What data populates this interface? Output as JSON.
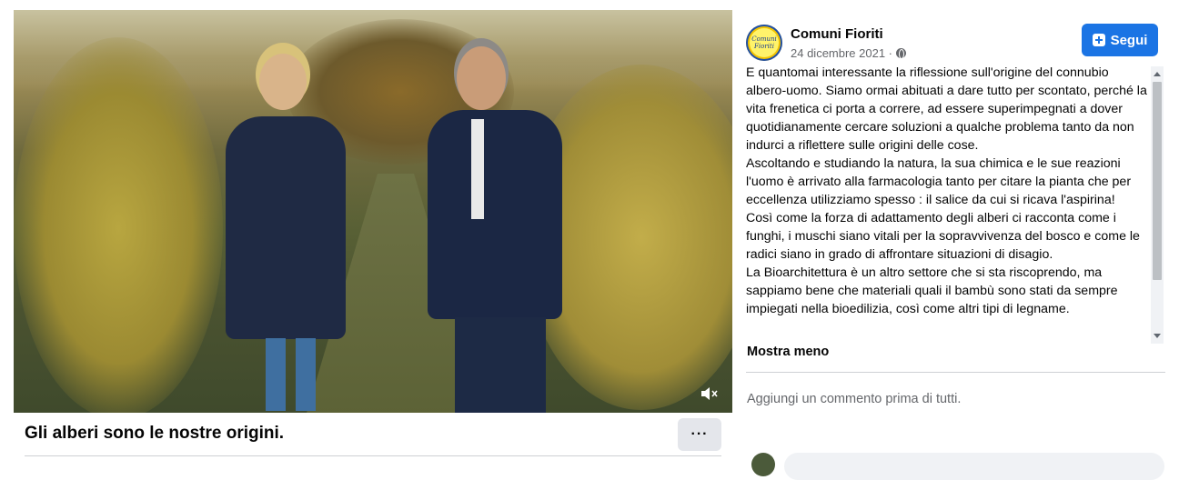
{
  "video": {
    "title": "Gli alberi sono le nostre origini.",
    "more_label": "···",
    "mute_icon": "volume-muted-icon"
  },
  "post": {
    "page_name": "Comuni Fioriti",
    "avatar_text": "Comuni Fioriti",
    "date": "24 dicembre 2021 ·",
    "privacy_icon": "globe-icon",
    "follow_label": "Segui",
    "paragraphs": [
      "E quantomai interessante la riflessione sull'origine del connubio albero-uomo. Siamo ormai abituati a dare tutto per scontato, perché la vita frenetica ci porta a correre, ad essere superimpegnati a dover quotidianamente cercare soluzioni a qualche problema tanto da non indurci a riflettere sulle origini delle cose.",
      "Ascoltando e studiando la natura, la sua chimica e le sue reazioni l'uomo è arrivato alla farmacologia tanto per citare la pianta che per eccellenza utilizziamo spesso : il salice da cui si ricava l'aspirina!",
      "Così come la forza di adattamento degli alberi ci racconta come i funghi, i muschi siano vitali per la sopravvivenza del bosco e come le radici siano in grado di affrontare situazioni di disagio.",
      "La Bioarchitettura è un altro settore che si sta riscoprendo, ma sappiamo bene che materiali quali il bambù sono stati da sempre impiegati nella bioedilizia, così come altri tipi di legname."
    ],
    "show_less": "Mostra meno",
    "no_comments": "Aggiungi un commento prima di tutti."
  },
  "colors": {
    "accent": "#1b74e4",
    "secondary_text": "#65676b",
    "button_gray": "#e4e6eb"
  }
}
